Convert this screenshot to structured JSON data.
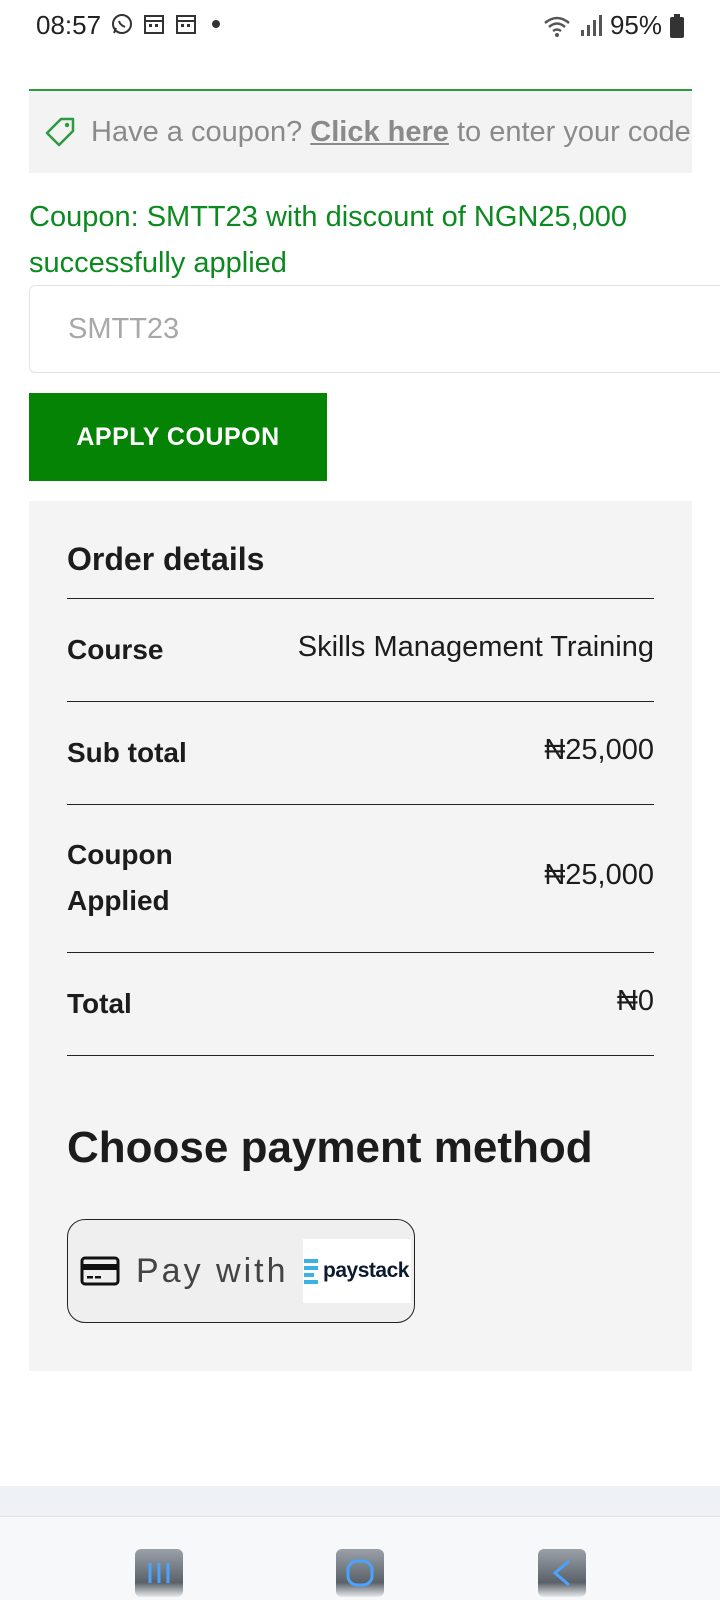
{
  "status_bar": {
    "time": "08:57",
    "battery": "95%",
    "left_icons": [
      "whatsapp-icon",
      "calendar-icon",
      "calendar-icon",
      "dot-icon"
    ],
    "right_icons": [
      "wifi-icon",
      "signal-icon",
      "battery-icon"
    ]
  },
  "coupon_notice": {
    "prefix": "Have a coupon? ",
    "link": "Click here",
    "suffix": " to enter your code",
    "icon": "tag-icon"
  },
  "coupon_success": "Coupon: SMTT23 with discount of NGN25,000 successfully applied",
  "coupon_input": {
    "value": "SMTT23"
  },
  "apply_button": "APPLY COUPON",
  "order": {
    "title": "Order details",
    "rows": [
      {
        "label": "Course",
        "value": "Skills Management Training"
      },
      {
        "label": "Sub total",
        "value": "₦25,000"
      },
      {
        "label": "Coupon Applied",
        "value": "₦25,000"
      },
      {
        "label": "Total",
        "value": "₦0"
      }
    ]
  },
  "payment": {
    "title": "Choose payment method",
    "button_text": "Pay with",
    "provider": "paystack",
    "icon": "credit-card-icon"
  },
  "nav": {
    "icons": [
      "recent-apps-icon",
      "home-icon",
      "back-icon"
    ]
  },
  "colors": {
    "accent_green": "#048304",
    "success_text": "#0b8a1f",
    "panel_bg": "#f4f4f4"
  }
}
